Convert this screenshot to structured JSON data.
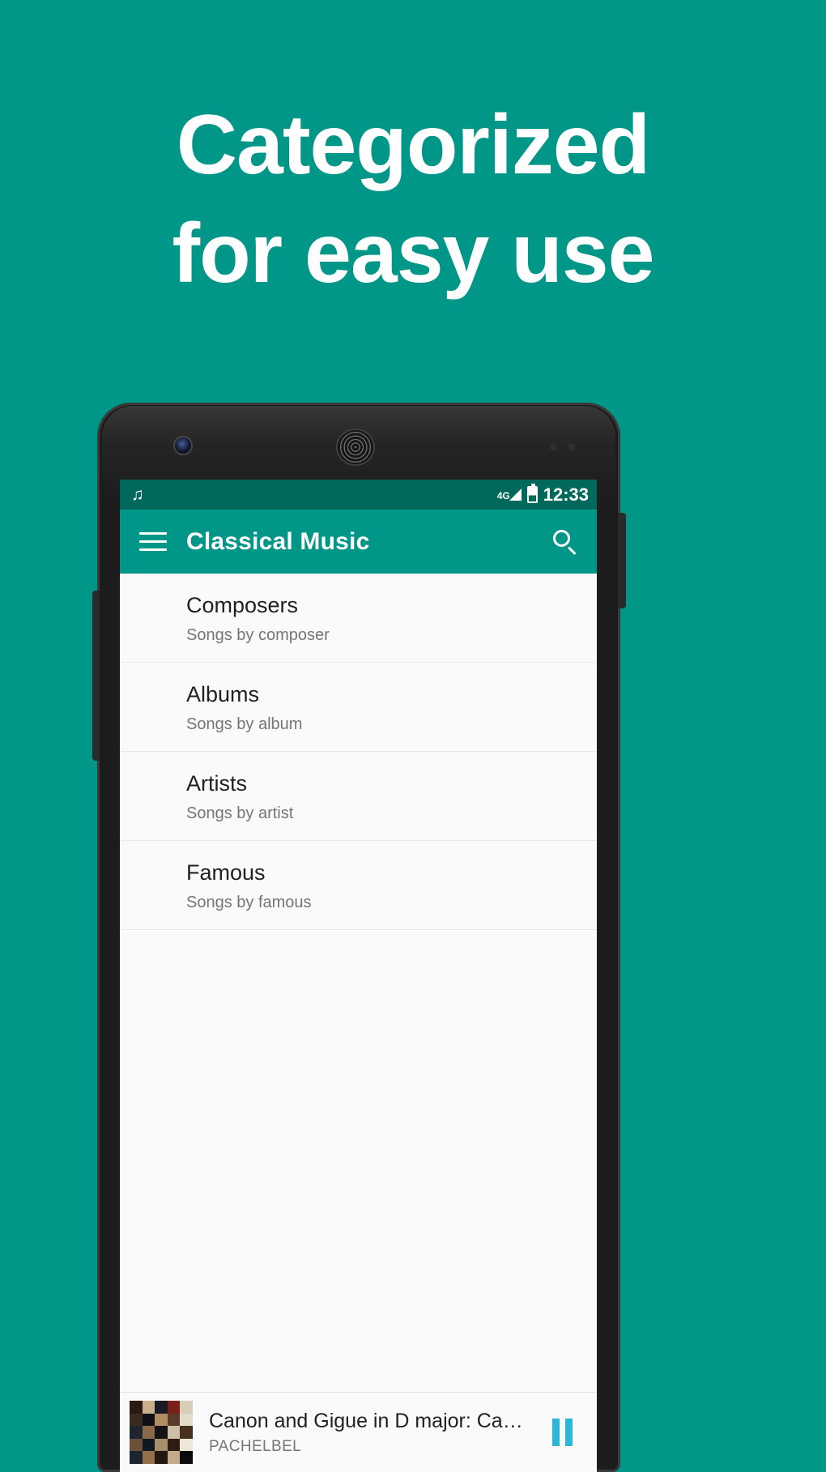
{
  "promo": {
    "headline_line1": "Categorized",
    "headline_line2": "for easy use",
    "background_color": "#009688",
    "text_color": "#ffffff"
  },
  "phone": {
    "status_bar": {
      "background_color": "#00695c",
      "notification_icon": "music-note-icon",
      "notification_glyph": "♫",
      "network_label": "4G",
      "signal_icon": "signal-bars-icon",
      "battery_icon": "battery-icon",
      "clock": "12:33"
    },
    "app_bar": {
      "background_color": "#009688",
      "menu_icon": "hamburger-menu-icon",
      "title": "Classical Music",
      "search_icon": "search-icon"
    },
    "list": {
      "items": [
        {
          "title": "Composers",
          "subtitle": "Songs by composer"
        },
        {
          "title": "Albums",
          "subtitle": "Songs by album"
        },
        {
          "title": "Artists",
          "subtitle": "Songs by artist"
        },
        {
          "title": "Famous",
          "subtitle": "Songs by famous"
        }
      ]
    },
    "player": {
      "album_art": "composer-portraits-collage",
      "track_title": "Canon and Gigue in D major: Ca…",
      "artist": "PACHELBEL",
      "control_icon": "pause-icon",
      "control_color": "#29b6d8"
    }
  }
}
